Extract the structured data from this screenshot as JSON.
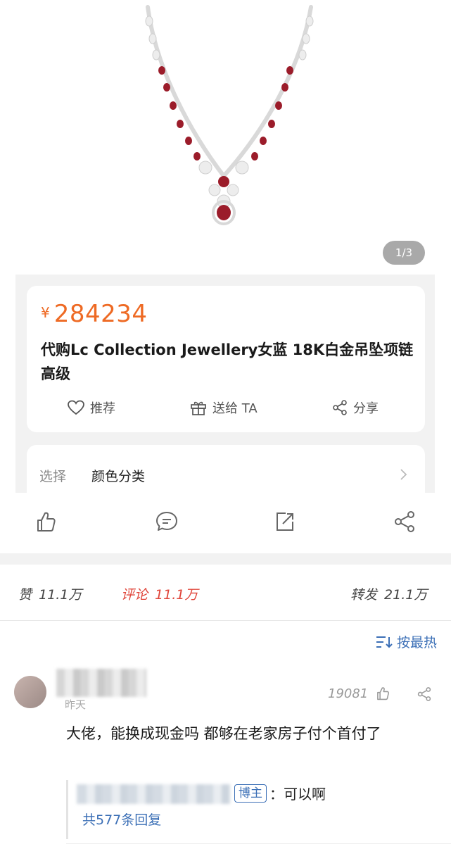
{
  "product": {
    "image_counter": "1/3",
    "price_currency": "¥",
    "price": "284234",
    "title": "代购Lc Collection Jewellery女蓝 18K白金吊坠项链高级",
    "actions": {
      "recommend": "推荐",
      "gift": "送给 TA",
      "share": "分享"
    },
    "select_label": "选择",
    "select_value": "颜色分类"
  },
  "stats": {
    "like_label": "赞",
    "like_count": "11.1万",
    "comment_label": "评论",
    "comment_count": "11.1万",
    "repost_label": "转发",
    "repost_count": "21.1万"
  },
  "sort": {
    "label": "按最热"
  },
  "comment": {
    "time": "昨天",
    "likes": "19081",
    "text": "大佬，能换成现金吗 都够在老家房子付个首付了",
    "reply": {
      "badge": "博主",
      "text": "：可以啊",
      "count": "共577条回复"
    }
  },
  "colors": {
    "price": "#ee6a24",
    "comment_stat": "#e0453a",
    "link_blue": "#3b6fb6",
    "ruby": "#9b1c2a"
  },
  "icons": [
    "heart-icon",
    "gift-icon",
    "share-icon",
    "chevron-right-icon",
    "like-icon",
    "comment-icon",
    "repost-icon",
    "sort-icon"
  ]
}
